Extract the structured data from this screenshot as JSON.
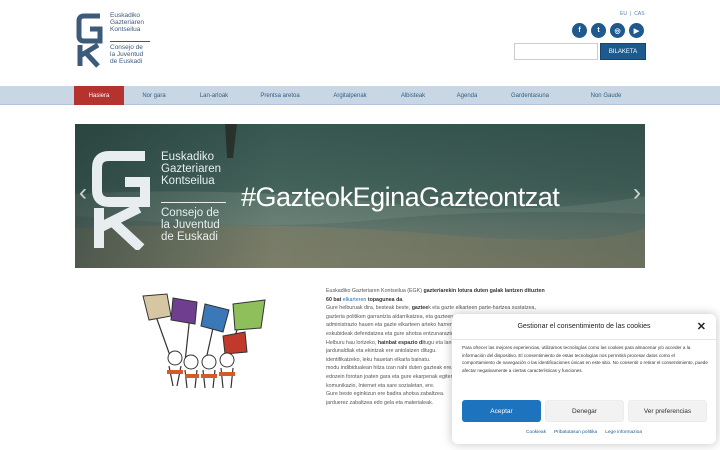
{
  "header": {
    "logo_eu": [
      "Euskadiko",
      "Gazteriaren",
      "Kontseilua"
    ],
    "logo_es": [
      "Consejo de",
      "la Juventud",
      "de Euskadi"
    ],
    "lang": [
      "EU",
      "CAS"
    ],
    "social": [
      {
        "icon": "facebook-icon",
        "glyph": "f"
      },
      {
        "icon": "twitter-icon",
        "glyph": "t"
      },
      {
        "icon": "instagram-icon",
        "glyph": "◎"
      },
      {
        "icon": "youtube-icon",
        "glyph": "▶"
      }
    ],
    "search_placeholder": "",
    "search_button": "BILAKETA"
  },
  "nav": {
    "items": [
      "Hasiera",
      "Nor gara",
      "Lan-arloak",
      "Prentsa aretoa",
      "Argitalpenak",
      "Albisteak",
      "Agenda",
      "Gardentasuna",
      "Non Gaude"
    ],
    "active_index": 0
  },
  "banner": {
    "hashtag": "#GazteokEginaGazteontzat",
    "org_eu": [
      "Euskadiko",
      "Gazteriaren",
      "Kontseilua"
    ],
    "org_es": [
      "Consejo de",
      "la Juventud",
      "de Euskadi"
    ],
    "prev": "‹",
    "next": "›"
  },
  "content": {
    "rows": [
      [
        {
          "t": "Euskadiko Gazteriaren Kontseilua (EGK) "
        },
        {
          "t": "gazteriarekin lotura duten galak lantzen dituzten",
          "b": true
        }
      ],
      [
        {
          "t": "60 bat ",
          "b": true
        },
        {
          "t": "elkarteren",
          "link": true
        },
        {
          "t": " topagunea da",
          "b": true
        },
        {
          "t": "."
        }
      ],
      [
        {
          "t": "Gure helburuak dira, besteak beste, "
        },
        {
          "t": "gaztee",
          "b": true
        },
        {
          "t": "k eta gazte elkarteen parte-hartzea sustatzea,"
        }
      ],
      [
        {
          "t": "gazteria politiken garrantzia aldarrikatzea, e"
        },
        {
          "t": "ta gazteen ahotsa dituen beste eragileekin"
        }
      ],
      [
        {
          "t": "administrazio hauen eta gazte elkartee"
        },
        {
          "t": "n arteko harremanak sustatzea."
        }
      ],
      [
        {
          "t": "eskubideak defendatzea eta gure ahotsa en"
        },
        {
          "t": "tzunaraztea."
        }
      ],
      [
        {
          "t": "Helburu hau lortzeko, "
        },
        {
          "t": "hainbat espazio di",
          "b": true
        },
        {
          "t": "tugu eta lan-ildo ezberdinak."
        }
      ],
      [
        {
          "t": "jardunaldiak eta ekintzak ere antolatze"
        },
        {
          "t": "n ditugu."
        }
      ],
      [
        {
          "t": "identifikatzeko, leku hauetan elkarla bainat"
        },
        {
          "t": "u."
        }
      ],
      [
        {
          "t": "modu indibidualean hitza izan nahi duten"
        },
        {
          "t": " gazteak ere."
        }
      ],
      [
        {
          "t": "edozein forotan joaten gara eta gure"
        },
        {
          "t": " ekarpenak egiten."
        }
      ],
      [
        {
          "t": "komunikazio, Internet eta sare sozialetan,"
        },
        {
          "t": " ere."
        }
      ],
      [
        {
          "t": "Gure beste eginkizun ere badira aho"
        },
        {
          "t": "tsa zabaltzea."
        }
      ],
      [
        {
          "t": "jarduerez zabaltzea edo gela eta materiale"
        },
        {
          "t": "ak."
        }
      ]
    ]
  },
  "cookie": {
    "title": "Gestionar el consentimiento de las cookies",
    "body": "Para ofrecer las mejores experiencias, utilizamos tecnologías como las cookies para almacenar y/o acceder a la información del dispositivo. El consentimiento de estas tecnologías nos permitirá procesar datos como el comportamiento de navegación o las identificaciones únicas en este sitio. No consentir o retirar el consentimiento, puede afectar negativamente a ciertas características y funciones.",
    "accept": "Aceptar",
    "deny": "Denegar",
    "prefs": "Ver preferencias",
    "links": [
      "Cookieak",
      "Pribatutasun politika",
      "Lege informazioa"
    ],
    "close": "✕"
  },
  "colors": {
    "nav_bg": "#c9d7e4",
    "nav_active": "#b5332f",
    "brand_blue": "#1d5b8f",
    "accept_blue": "#1e73be"
  }
}
